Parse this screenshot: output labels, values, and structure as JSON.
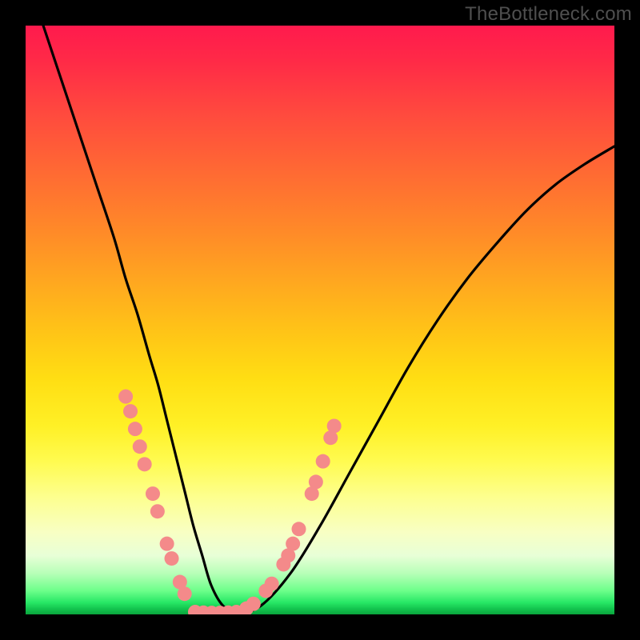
{
  "watermark": "TheBottleneck.com",
  "chart_data": {
    "type": "line",
    "title": "",
    "xlabel": "",
    "ylabel": "",
    "xlim": [
      0,
      100
    ],
    "ylim": [
      0,
      100
    ],
    "grid": false,
    "legend": false,
    "series": [
      {
        "name": "bottleneck-curve",
        "color": "#000000",
        "x": [
          3,
          6,
          9,
          12,
          15,
          17,
          19,
          21,
          22.5,
          24,
          25.5,
          27,
          28.5,
          30,
          31.5,
          33.5,
          36,
          40,
          45,
          50,
          55,
          60,
          65,
          70,
          75,
          80,
          85,
          90,
          95,
          100
        ],
        "y": [
          100,
          91,
          82,
          73,
          64,
          57,
          51,
          44,
          39,
          33,
          27,
          21,
          15,
          10,
          5,
          1.5,
          0.2,
          1.5,
          7,
          15,
          24,
          33,
          42,
          50,
          57,
          63,
          68.5,
          73,
          76.5,
          79.5
        ]
      }
    ],
    "markers": [
      {
        "name": "left-cluster",
        "color": "#f48a8a",
        "r": 9,
        "points": [
          {
            "x": 17.0,
            "y": 37.0
          },
          {
            "x": 17.8,
            "y": 34.5
          },
          {
            "x": 18.6,
            "y": 31.5
          },
          {
            "x": 19.4,
            "y": 28.5
          },
          {
            "x": 20.2,
            "y": 25.5
          },
          {
            "x": 21.6,
            "y": 20.5
          },
          {
            "x": 22.4,
            "y": 17.5
          },
          {
            "x": 24.0,
            "y": 12.0
          },
          {
            "x": 24.8,
            "y": 9.5
          },
          {
            "x": 26.2,
            "y": 5.5
          },
          {
            "x": 27.0,
            "y": 3.5
          }
        ]
      },
      {
        "name": "right-cluster",
        "color": "#f48a8a",
        "r": 9,
        "points": [
          {
            "x": 37.5,
            "y": 1.0
          },
          {
            "x": 38.7,
            "y": 1.8
          },
          {
            "x": 40.8,
            "y": 4.0
          },
          {
            "x": 41.8,
            "y": 5.2
          },
          {
            "x": 43.8,
            "y": 8.5
          },
          {
            "x": 44.6,
            "y": 10.0
          },
          {
            "x": 45.4,
            "y": 12.0
          },
          {
            "x": 46.4,
            "y": 14.5
          },
          {
            "x": 48.6,
            "y": 20.5
          },
          {
            "x": 49.3,
            "y": 22.5
          },
          {
            "x": 50.5,
            "y": 26.0
          },
          {
            "x": 51.8,
            "y": 30.0
          },
          {
            "x": 52.4,
            "y": 32.0
          }
        ]
      },
      {
        "name": "floor-cluster",
        "color": "#f48a8a",
        "r": 9,
        "points": [
          {
            "x": 28.8,
            "y": 0.4
          },
          {
            "x": 30.2,
            "y": 0.3
          },
          {
            "x": 31.6,
            "y": 0.25
          },
          {
            "x": 33.0,
            "y": 0.25
          },
          {
            "x": 34.4,
            "y": 0.3
          },
          {
            "x": 35.8,
            "y": 0.4
          }
        ]
      }
    ]
  }
}
